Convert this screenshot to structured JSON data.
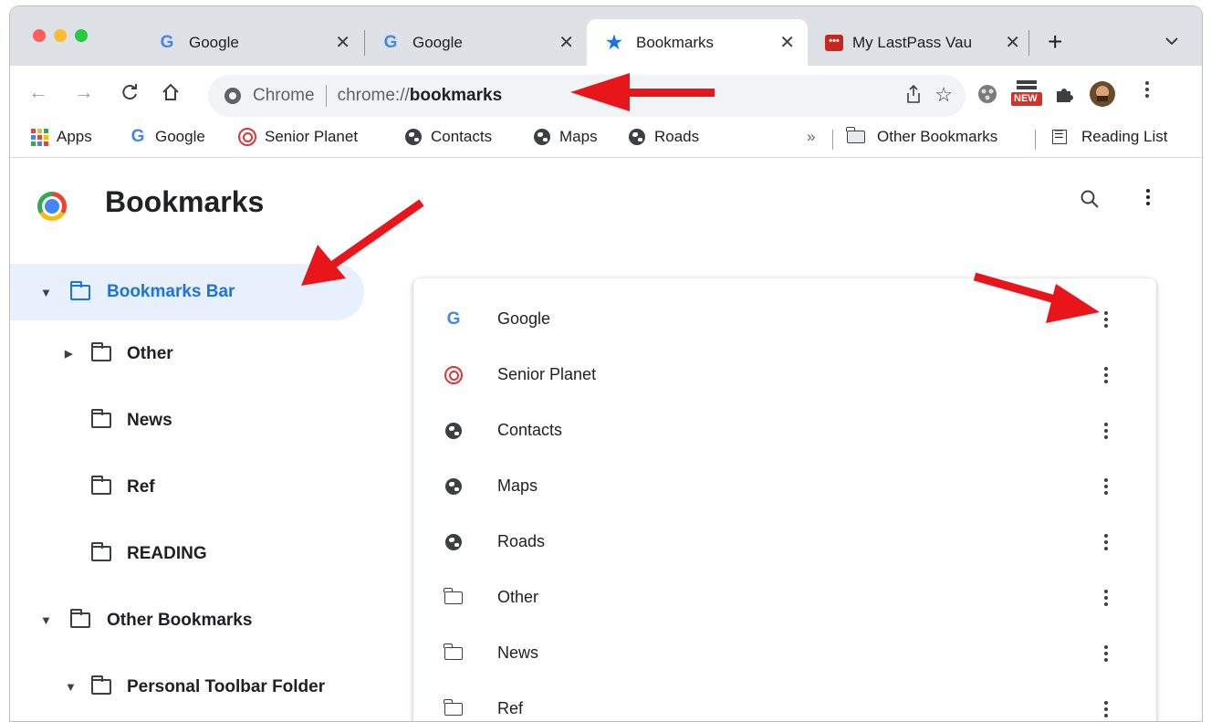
{
  "tabs": [
    {
      "icon": "google-g-icon",
      "title": "Google"
    },
    {
      "icon": "google-g-icon",
      "title": "Google"
    },
    {
      "icon": "star-icon",
      "title": "Bookmarks"
    },
    {
      "icon": "lastpass-icon",
      "title": "My LastPass Vau"
    }
  ],
  "omnibox": {
    "site_label": "Chrome",
    "url_prefix": "chrome://",
    "url": "bookmarks"
  },
  "extensions": {
    "new_badge": "NEW"
  },
  "bookmarks_bar": {
    "items": [
      {
        "icon": "apps-grid-icon",
        "label": "Apps"
      },
      {
        "icon": "google-g-icon",
        "label": "Google"
      },
      {
        "icon": "senior-planet-icon",
        "label": "Senior Planet"
      },
      {
        "icon": "globe-icon",
        "label": "Contacts"
      },
      {
        "icon": "globe-icon",
        "label": "Maps"
      },
      {
        "icon": "globe-icon",
        "label": "Roads"
      }
    ],
    "overflow": "»",
    "other_bookmarks": "Other Bookmarks",
    "reading_list": "Reading List"
  },
  "page": {
    "title": "Bookmarks"
  },
  "sidebar": {
    "items": [
      {
        "label": "Bookmarks Bar",
        "caret": "▼",
        "selected": true
      },
      {
        "label": "Other",
        "caret": "▶"
      },
      {
        "label": "News",
        "caret": ""
      },
      {
        "label": "Ref",
        "caret": ""
      },
      {
        "label": "READING",
        "caret": ""
      },
      {
        "label": "Other Bookmarks",
        "caret": "▼"
      },
      {
        "label": "Personal Toolbar Folder",
        "caret": "▼"
      }
    ]
  },
  "list": {
    "items": [
      {
        "icon": "google-g-icon",
        "label": "Google"
      },
      {
        "icon": "senior-planet-icon",
        "label": "Senior Planet"
      },
      {
        "icon": "globe-icon",
        "label": "Contacts"
      },
      {
        "icon": "globe-icon",
        "label": "Maps"
      },
      {
        "icon": "globe-icon",
        "label": "Roads"
      },
      {
        "icon": "folder-icon",
        "label": "Other"
      },
      {
        "icon": "folder-icon",
        "label": "News"
      },
      {
        "icon": "folder-icon",
        "label": "Ref"
      }
    ]
  },
  "colors": {
    "accent_blue": "#1a73e8",
    "selected_bg": "#e8f0fe",
    "annotation_arrow": "#e8161b",
    "tabstrip_bg": "#dee1e6"
  }
}
